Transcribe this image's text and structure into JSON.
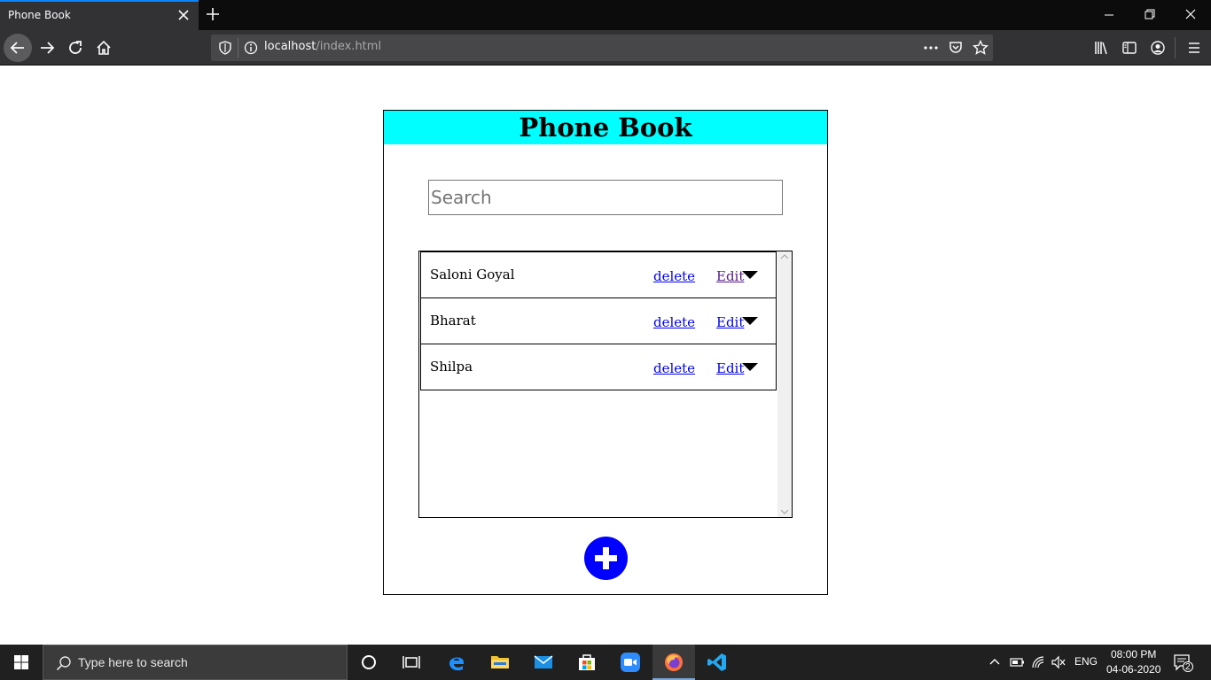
{
  "browser": {
    "tab_title": "Phone Book",
    "url_host": "localhost",
    "url_path": "/index.html"
  },
  "page": {
    "title": "Phone Book",
    "search_placeholder": "Search",
    "contacts": [
      {
        "name": "Saloni Goyal",
        "delete_label": "delete",
        "edit_label": "Edit"
      },
      {
        "name": "Bharat",
        "delete_label": "delete",
        "edit_label": "Edit"
      },
      {
        "name": "Shilpa",
        "delete_label": "delete",
        "edit_label": "Edit"
      }
    ],
    "colors": {
      "header_bg": "#00ffff",
      "add_button": "#0000ff",
      "link": "#0000ee"
    }
  },
  "taskbar": {
    "search_placeholder": "Type here to search",
    "language": "ENG",
    "time": "08:00 PM",
    "date": "04-06-2020",
    "notification_count": "2"
  }
}
